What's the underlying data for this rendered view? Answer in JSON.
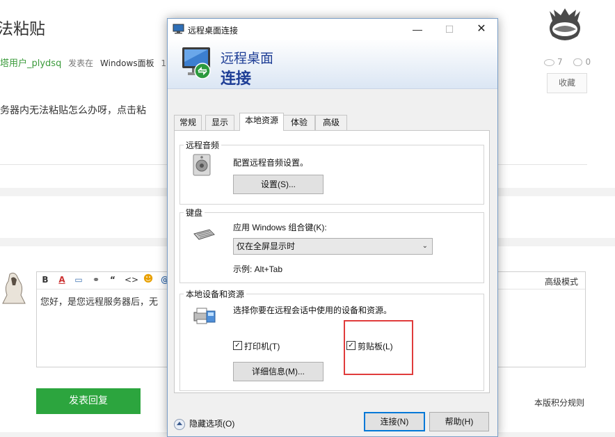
{
  "forum": {
    "title_fragment": "法粘贴",
    "author": "塔用户_plydsq",
    "posted_in_label": "发表在",
    "board": "Windows面板",
    "time_fragment": "11 分",
    "body_fragment": "务器内无法粘贴怎么办呀，点击粘",
    "views": "7",
    "comments": "0",
    "favorite_label": "收藏",
    "editor": {
      "toolbar_items": [
        "B",
        "A",
        "▭",
        "⚭",
        "“",
        "<>",
        "☻",
        "@"
      ],
      "advanced_mode": "高级模式",
      "text_fragment": "您好，是您远程服务器后，无"
    },
    "submit_label": "发表回复",
    "rules_link": "本版积分规则"
  },
  "dialog": {
    "title": "远程桌面连接",
    "banner_line1": "远程桌面",
    "banner_line2": "连接",
    "tabs": [
      {
        "label": "常规",
        "active": false
      },
      {
        "label": "显示",
        "active": false
      },
      {
        "label": "本地资源",
        "active": true
      },
      {
        "label": "体验",
        "active": false
      },
      {
        "label": "高级",
        "active": false
      }
    ],
    "audio": {
      "group_label": "远程音频",
      "description": "配置远程音频设置。",
      "button": "设置(S)..."
    },
    "keyboard": {
      "group_label": "键盘",
      "description": "应用 Windows 组合键(K):",
      "selected_option": "仅在全屏显示时",
      "example": "示例: Alt+Tab"
    },
    "local_devices": {
      "group_label": "本地设备和资源",
      "description": "选择你要在远程会话中使用的设备和资源。",
      "printer_label": "打印机(T)",
      "printer_checked": true,
      "clipboard_label": "剪贴板(L)",
      "clipboard_checked": true,
      "details_button": "详细信息(M)..."
    },
    "hide_options": "隐藏选项(O)",
    "connect_button": "连接(N)",
    "help_button": "帮助(H)",
    "highlight_color": "#e03b3b",
    "banner_text_color": "#1e3e96"
  }
}
